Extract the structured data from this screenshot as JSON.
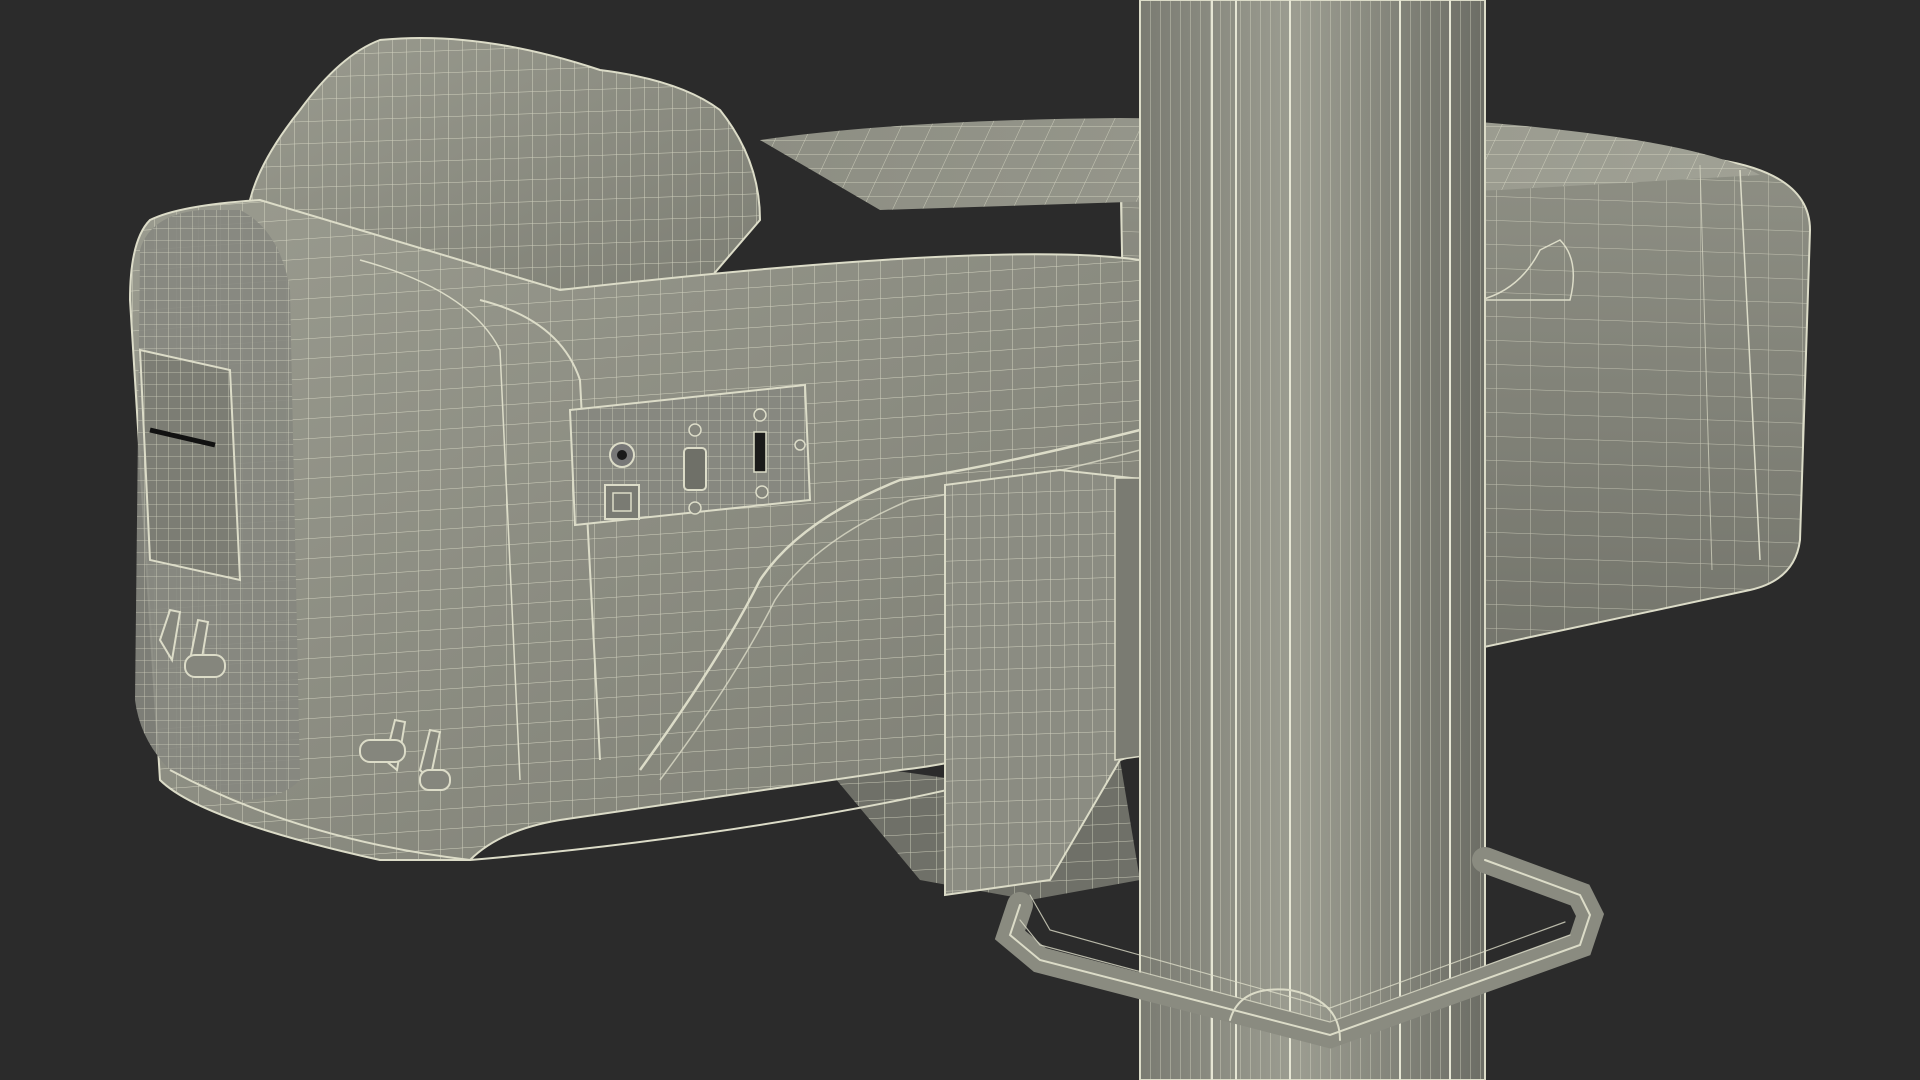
{
  "scene": {
    "background_color": "#2b2b2b",
    "surface_color": "#8a8b80",
    "surface_shadow_color": "#6d6e65",
    "surface_highlight_color": "#a3a497",
    "wire_color": "#dcdcc8",
    "wire_color_dim": "#b9b9a6",
    "port_dark_color": "#1a1a1a",
    "render_mode": "wireframe-on-shaded"
  }
}
